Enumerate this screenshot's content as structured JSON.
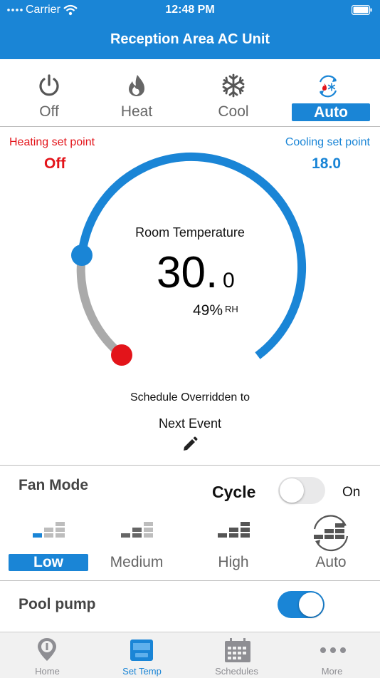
{
  "status_bar": {
    "carrier": "Carrier",
    "time": "12:48 PM"
  },
  "nav": {
    "title": "Reception Area AC Unit"
  },
  "modes": [
    {
      "label": "Off",
      "icon": "power-icon"
    },
    {
      "label": "Heat",
      "icon": "flame-icon"
    },
    {
      "label": "Cool",
      "icon": "snowflake-icon"
    },
    {
      "label": "Auto",
      "icon": "auto-cycle-icon",
      "selected": true
    }
  ],
  "setpoints": {
    "heating_label": "Heating set point",
    "heating_value": "Off",
    "cooling_label": "Cooling set point",
    "cooling_value": "18.0"
  },
  "room": {
    "label": "Room Temperature",
    "temp_int": "30.",
    "temp_dec": "0",
    "humidity": "49%",
    "humidity_unit": "RH"
  },
  "schedule": {
    "label": "Schedule Overridden to",
    "value": "Next Event"
  },
  "fan": {
    "title": "Fan Mode",
    "cycle_label": "Cycle",
    "cycle_on": false,
    "on_label": "On",
    "speeds": [
      {
        "label": "Low",
        "selected": true
      },
      {
        "label": "Medium"
      },
      {
        "label": "High"
      },
      {
        "label": "Auto"
      }
    ]
  },
  "pool": {
    "label": "Pool pump",
    "on": true
  },
  "tabs": [
    {
      "label": "Home",
      "icon": "location-pin-icon"
    },
    {
      "label": "Set Temp",
      "icon": "thermostat-icon",
      "selected": true
    },
    {
      "label": "Schedules",
      "icon": "calendar-icon"
    },
    {
      "label": "More",
      "icon": "more-dots-icon"
    }
  ],
  "colors": {
    "accent": "#1a85d6",
    "heat": "#e3141a",
    "track": "#aaaaaa"
  }
}
